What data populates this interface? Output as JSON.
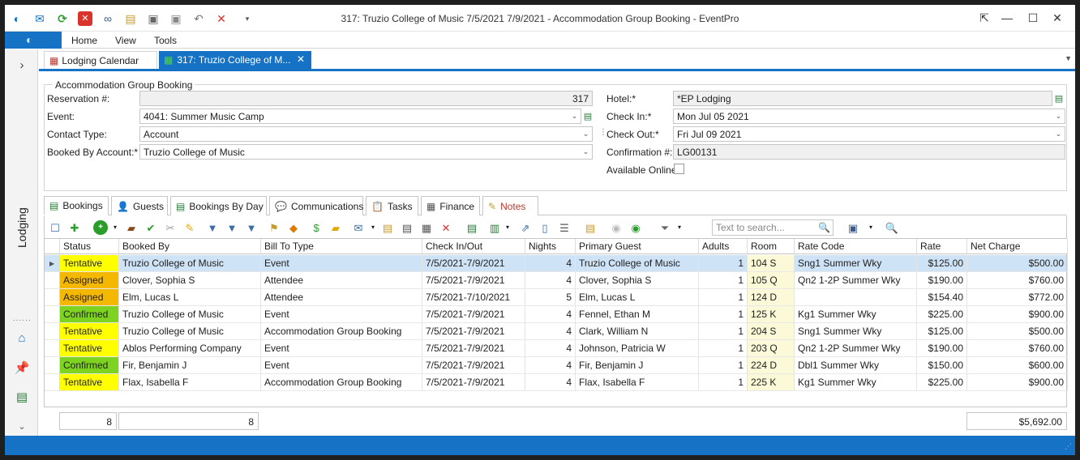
{
  "window": {
    "title": "317: Truzio College of Music 7/5/2021 7/9/2021 - Accommodation Group Booking - EventPro"
  },
  "ribbon": {
    "tabs": [
      "Home",
      "View",
      "Tools"
    ]
  },
  "sidebar": {
    "label": "Lodging"
  },
  "doc_tabs": [
    {
      "label": "Lodging Calendar",
      "icon": "calendar-icon"
    },
    {
      "label": "317: Truzio College of M...",
      "icon": "grid-icon"
    }
  ],
  "form": {
    "group_title": "Accommodation Group Booking",
    "reservation_label": "Reservation #:",
    "reservation_value": "317",
    "event_label": "Event:",
    "event_value": "4041: Summer Music Camp",
    "contact_type_label": "Contact Type:",
    "contact_type_value": "Account",
    "booked_by_label": "Booked By Account:*",
    "booked_by_value": "Truzio College of Music",
    "hotel_label": "Hotel:*",
    "hotel_value": "*EP Lodging",
    "check_in_label": "Check In:*",
    "check_in_value": "Mon Jul 05 2021",
    "check_out_label": "Check Out:*",
    "check_out_value": "Fri Jul 09 2021",
    "confirmation_label": "Confirmation #:",
    "confirmation_value": "LG00131",
    "available_online_label": "Available Online"
  },
  "sub_tabs": [
    "Bookings",
    "Guests",
    "Bookings By Day",
    "Communications",
    "Tasks",
    "Finance",
    "Notes"
  ],
  "search": {
    "placeholder": "Text to search..."
  },
  "columns": [
    "Status",
    "Booked By",
    "Bill To Type",
    "Check In/Out",
    "Nights",
    "Primary Guest",
    "Adults",
    "Room",
    "Rate Code",
    "Rate",
    "Net Charge"
  ],
  "rows": [
    [
      "Tentative",
      "Truzio College of Music",
      "Event",
      "7/5/2021-7/9/2021",
      "4",
      "Truzio College of Music",
      "1",
      "104 S",
      "Sng1 Summer Wky",
      "$125.00",
      "$500.00"
    ],
    [
      "Assigned",
      "Clover, Sophia S",
      "Attendee",
      "7/5/2021-7/9/2021",
      "4",
      "Clover, Sophia S",
      "1",
      "105 Q",
      "Qn2 1-2P Summer Wky",
      "$190.00",
      "$760.00"
    ],
    [
      "Assigned",
      "Elm, Lucas L",
      "Attendee",
      "7/5/2021-7/10/2021",
      "5",
      "Elm, Lucas L",
      "1",
      "124 D",
      "",
      "$154.40",
      "$772.00"
    ],
    [
      "Confirmed",
      "Truzio College of Music",
      "Event",
      "7/5/2021-7/9/2021",
      "4",
      "Fennel, Ethan M",
      "1",
      "125 K",
      "Kg1 Summer Wky",
      "$225.00",
      "$900.00"
    ],
    [
      "Tentative",
      "Truzio College of Music",
      "Accommodation Group Booking",
      "7/5/2021-7/9/2021",
      "4",
      "Clark, William N",
      "1",
      "204 S",
      "Sng1 Summer Wky",
      "$125.00",
      "$500.00"
    ],
    [
      "Tentative",
      "Ablos Performing Company",
      "Event",
      "7/5/2021-7/9/2021",
      "4",
      "Johnson, Patricia W",
      "1",
      "203 Q",
      "Qn2 1-2P Summer Wky",
      "$190.00",
      "$760.00"
    ],
    [
      "Confirmed",
      "Fir, Benjamin J",
      "Event",
      "7/5/2021-7/9/2021",
      "4",
      "Fir, Benjamin J",
      "1",
      "224 D",
      "Dbl1 Summer Wky",
      "$150.00",
      "$600.00"
    ],
    [
      "Tentative",
      "Flax, Isabella F",
      "Accommodation Group Booking",
      "7/5/2021-7/9/2021",
      "4",
      "Flax, Isabella F",
      "1",
      "225 K",
      "Kg1 Summer Wky",
      "$225.00",
      "$900.00"
    ]
  ],
  "totals": {
    "count_status": "8",
    "count_booked_by": "8",
    "net_charge_total": "$5,692.00"
  },
  "colors": {
    "accent": "#1672c4",
    "tentative": "#ffff00",
    "assigned": "#f5b800",
    "confirmed": "#7ed321",
    "selected_row": "#cfe3f6",
    "room_bg": "#fbf9d7"
  }
}
